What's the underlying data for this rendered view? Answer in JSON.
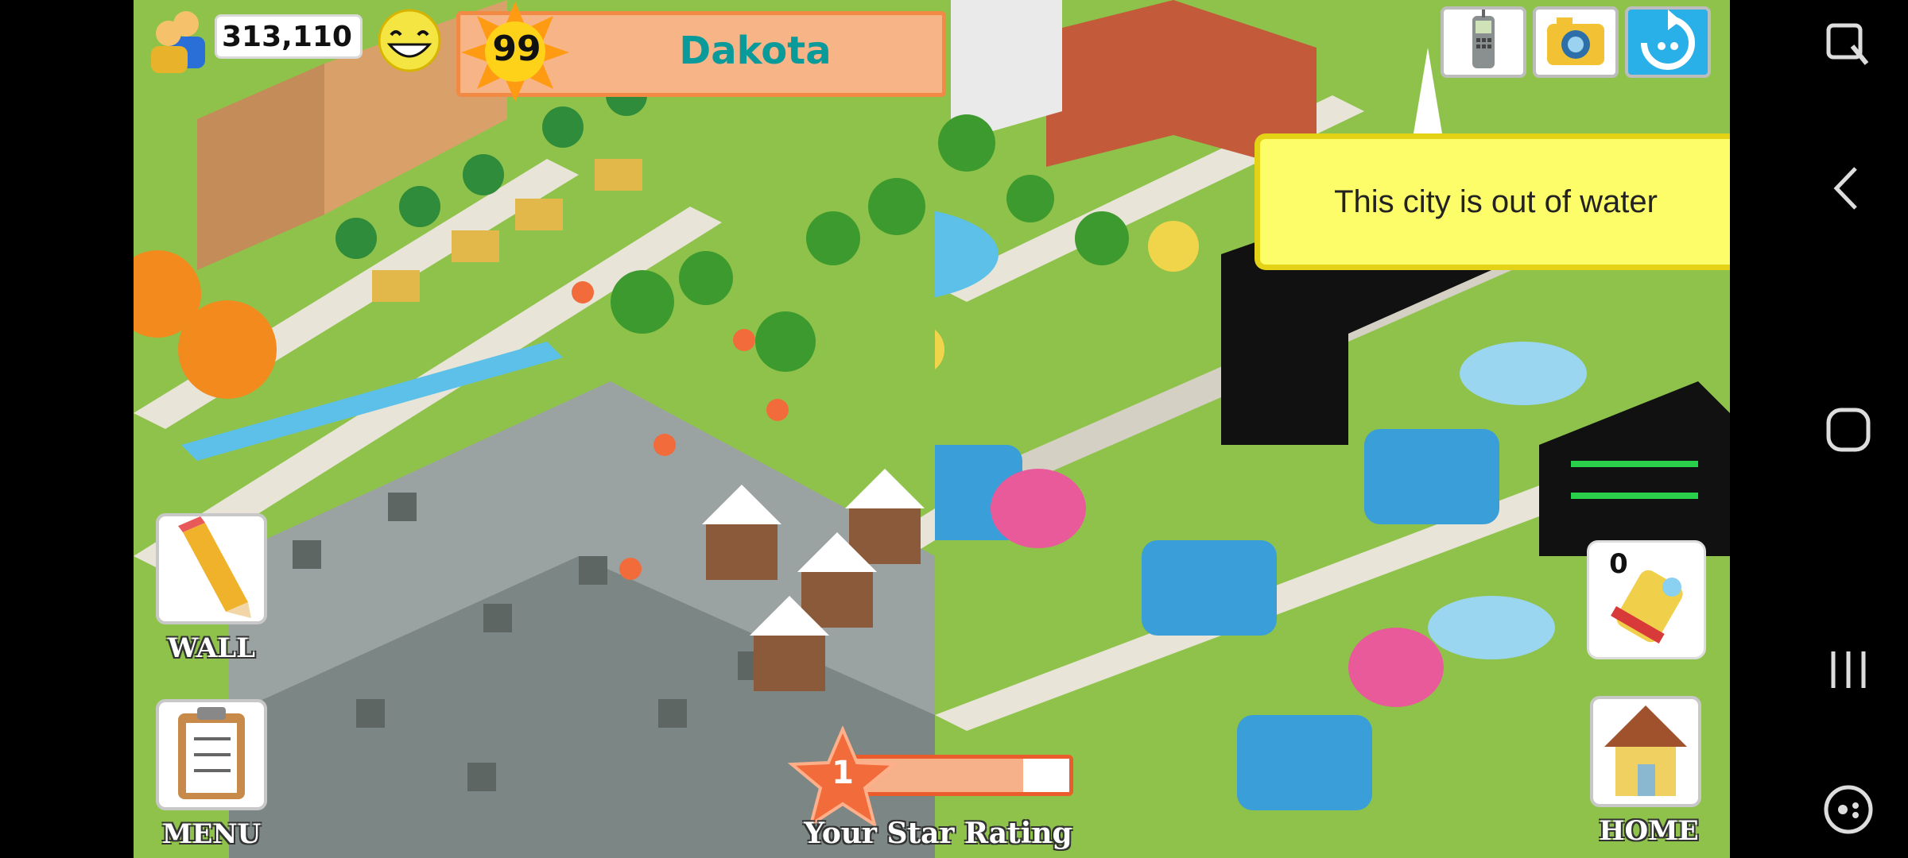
{
  "hud": {
    "coins": "313,110",
    "level": "99",
    "city_name": "Dakota"
  },
  "toast": {
    "message": "This city is out of water"
  },
  "side_buttons": {
    "wall_label": "WALL",
    "menu_label": "MENU",
    "home_label": "HOME"
  },
  "rating": {
    "value": "1",
    "label": "Your Star Rating",
    "progress_fraction": 0.8
  },
  "tool": {
    "count": "0"
  },
  "icons": {
    "top_right": [
      "phone-icon",
      "camera-icon",
      "refresh-icon"
    ],
    "nav": [
      "screenshot-icon",
      "back-icon",
      "home-circle-icon",
      "recents-icon",
      "game-launcher-icon"
    ]
  }
}
